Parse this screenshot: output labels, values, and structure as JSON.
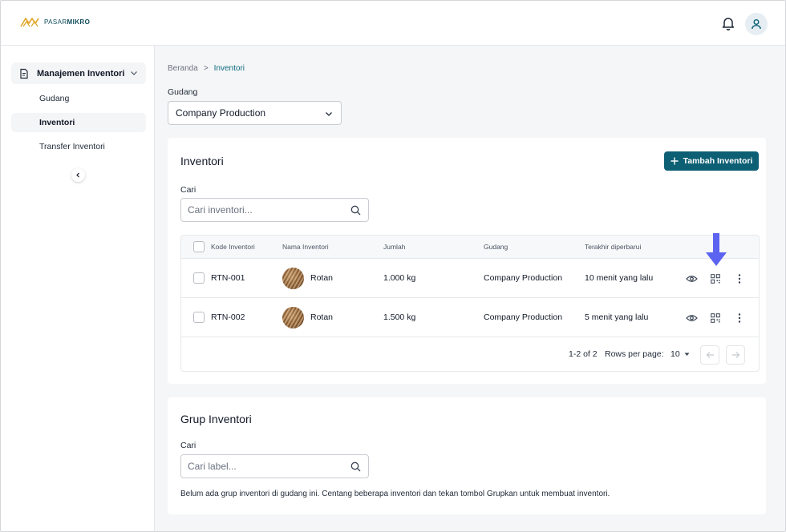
{
  "brand": {
    "logo_light": "PASAR",
    "logo_bold": "MIKRO"
  },
  "sidebar": {
    "group_label": "Manajemen Inventori",
    "items": [
      {
        "label": "Gudang",
        "active": false
      },
      {
        "label": "Inventori",
        "active": true
      },
      {
        "label": "Transfer Inventori",
        "active": false
      }
    ]
  },
  "breadcrumb": {
    "home": "Beranda",
    "separator": ">",
    "current": "Inventori"
  },
  "gudang": {
    "label": "Gudang",
    "selected": "Company Production"
  },
  "inventori_card": {
    "title": "Inventori",
    "add_button": "Tambah Inventori",
    "search_label": "Cari",
    "search_placeholder": "Cari inventori...",
    "columns": [
      "Kode Inventori",
      "Nama Inventori",
      "Jumlah",
      "Gudang",
      "Terakhir diperbarui"
    ],
    "rows": [
      {
        "kode": "RTN-001",
        "nama": "Rotan",
        "jumlah": "1.000 kg",
        "gudang": "Company Production",
        "updated": "10 menit yang lalu"
      },
      {
        "kode": "RTN-002",
        "nama": "Rotan",
        "jumlah": "1.500 kg",
        "gudang": "Company Production",
        "updated": "5 menit yang lalu"
      }
    ],
    "pagination": {
      "range": "1-2 of 2",
      "rows_per_page_label": "Rows per page:",
      "rows_per_page": "10"
    }
  },
  "grup_card": {
    "title": "Grup Inventori",
    "search_label": "Cari",
    "search_placeholder": "Cari label...",
    "empty_message": "Belum ada grup inventori di gudang ini. Centang beberapa inventori dan tekan tombol Grupkan untuk membuat inventori."
  },
  "colors": {
    "primary": "#0d5f74",
    "accent_arrow": "#5b63f0",
    "logo_gold": "#e0a526"
  },
  "icons": [
    "bell-icon",
    "user-icon",
    "document-icon",
    "chevron-down-icon",
    "chevron-left-icon",
    "search-icon",
    "plus-icon",
    "eye-icon",
    "qr-code-icon",
    "more-vertical-icon",
    "arrow-left-icon",
    "arrow-right-icon",
    "caret-down-icon"
  ]
}
